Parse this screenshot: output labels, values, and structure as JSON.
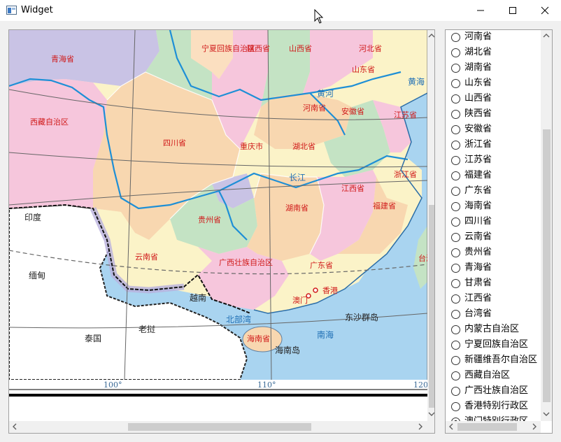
{
  "window": {
    "title": "Widget"
  },
  "map": {
    "province_labels": [
      "青海省",
      "宁夏回族自治区",
      "陕西省",
      "山西省",
      "河北省",
      "山东省",
      "西藏自治区",
      "四川省",
      "重庆市",
      "湖北省",
      "河南省",
      "安徽省",
      "江苏省",
      "浙江省",
      "贵州省",
      "湖南省",
      "江西省",
      "福建省",
      "云南省",
      "广西壮族自治区",
      "广东省",
      "香港",
      "澳门",
      "海南省",
      "台湾省"
    ],
    "sea_labels": [
      "北部湾",
      "东沙群岛",
      "海南岛",
      "南海",
      "黄海",
      "长江",
      "黄河"
    ],
    "foreign_labels": [
      "印度",
      "缅甸",
      "老挝",
      "越南",
      "泰国"
    ],
    "longitude_labels": [
      "100°",
      "110°",
      "120°"
    ]
  },
  "province_list": {
    "items": [
      {
        "label": "河南省",
        "checked": false
      },
      {
        "label": "湖北省",
        "checked": false
      },
      {
        "label": "湖南省",
        "checked": false
      },
      {
        "label": "山东省",
        "checked": false
      },
      {
        "label": "山西省",
        "checked": false
      },
      {
        "label": "陕西省",
        "checked": false
      },
      {
        "label": "安徽省",
        "checked": false
      },
      {
        "label": "浙江省",
        "checked": false
      },
      {
        "label": "江苏省",
        "checked": false
      },
      {
        "label": "福建省",
        "checked": false
      },
      {
        "label": "广东省",
        "checked": false
      },
      {
        "label": "海南省",
        "checked": false
      },
      {
        "label": "四川省",
        "checked": false
      },
      {
        "label": "云南省",
        "checked": false
      },
      {
        "label": "贵州省",
        "checked": false
      },
      {
        "label": "青海省",
        "checked": false
      },
      {
        "label": "甘肃省",
        "checked": false
      },
      {
        "label": "江西省",
        "checked": false
      },
      {
        "label": "台湾省",
        "checked": false
      },
      {
        "label": "内蒙古自治区",
        "checked": false
      },
      {
        "label": "宁夏回族自治区",
        "checked": false
      },
      {
        "label": "新疆维吾尔自治区",
        "checked": false
      },
      {
        "label": "西藏自治区",
        "checked": false
      },
      {
        "label": "广西壮族自治区",
        "checked": false
      },
      {
        "label": "香港特别行政区",
        "checked": false
      },
      {
        "label": "澳门特别行政区",
        "checked": true
      }
    ]
  },
  "colors": {
    "titlebar_bg": "#ffffff",
    "window_bg": "#f0f0f0",
    "sea": "#a9d4f0",
    "province_text": "#d01a1a",
    "river": "#1e8fd6"
  }
}
